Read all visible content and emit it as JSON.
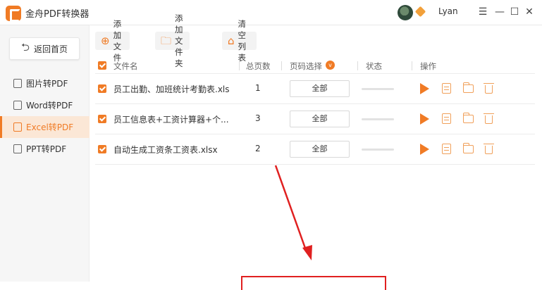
{
  "app": {
    "title": "金舟PDF转换器",
    "username": "Lyan"
  },
  "window_controls": {
    "menu": "☰",
    "minimize": "—",
    "maximize": "☐",
    "close": "✕"
  },
  "sidebar": {
    "home_label": "返回首页",
    "items": [
      {
        "label": "图片转PDF",
        "icon": "image-icon",
        "active": false
      },
      {
        "label": "Word转PDF",
        "icon": "word-doc-icon",
        "active": false
      },
      {
        "label": "Excel转PDF",
        "icon": "excel-doc-icon",
        "active": true
      },
      {
        "label": "PPT转PDF",
        "icon": "ppt-doc-icon",
        "active": false
      }
    ]
  },
  "toolbar": {
    "add_file": "添加文件",
    "add_folder": "添加文件夹",
    "clear_list": "清空列表"
  },
  "table": {
    "headers": {
      "filename": "文件名",
      "pages": "总页数",
      "page_select": "页码选择",
      "status": "状态",
      "actions": "操作"
    },
    "rows": [
      {
        "filename": "员工出勤、加班统计考勤表.xls",
        "pages": "1",
        "page_select": "全部",
        "progress": 0
      },
      {
        "filename": "员工信息表+工资计算器+个...",
        "pages": "3",
        "page_select": "全部",
        "progress": 0
      },
      {
        "filename": "自动生成工资条工资表.xlsx",
        "pages": "2",
        "page_select": "全部",
        "progress": 0
      }
    ]
  },
  "colors": {
    "accent": "#f07b25",
    "annotation": "#e02020"
  }
}
